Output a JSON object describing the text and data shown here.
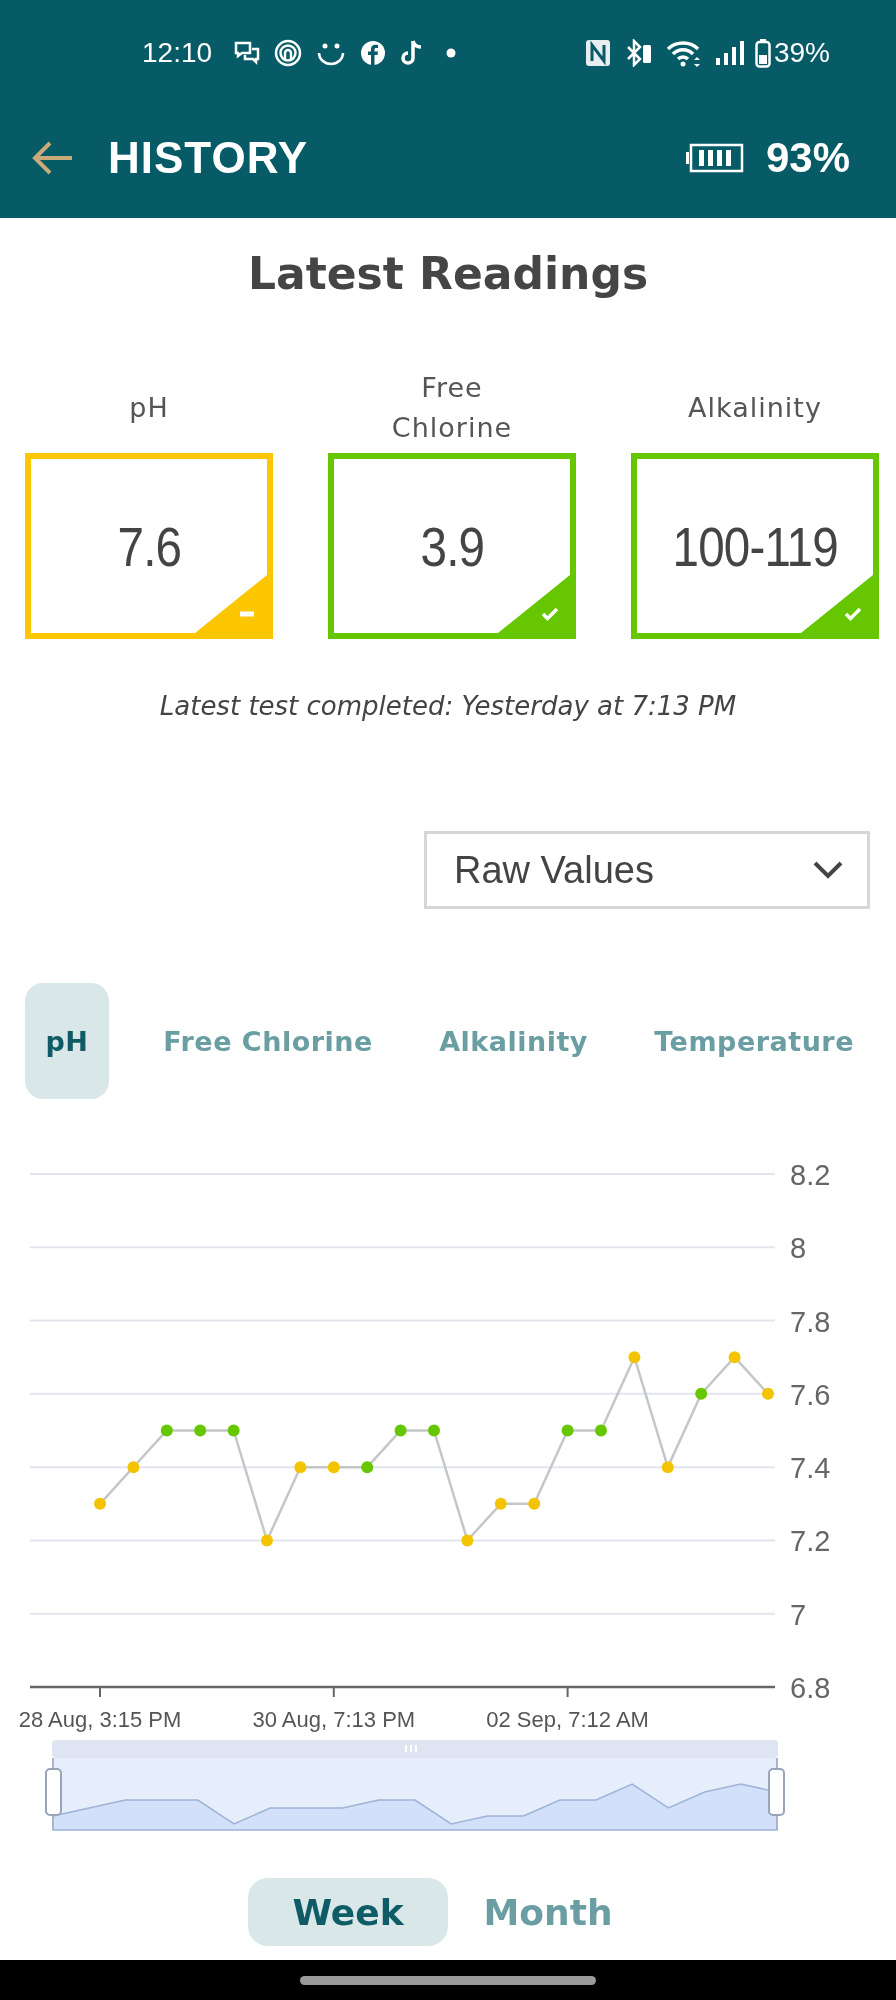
{
  "status_bar": {
    "time": "12:10",
    "battery": "39%"
  },
  "header": {
    "title": "HISTORY",
    "device_battery": "93%"
  },
  "latest": {
    "title": "Latest Readings",
    "readings": [
      {
        "label": "pH",
        "value": "7.6",
        "in_range": false
      },
      {
        "label": "Free Chlorine",
        "value": "3.9",
        "in_range": true
      },
      {
        "label": "Alkalinity",
        "value": "100-119",
        "in_range": true
      }
    ],
    "note": "Latest test completed: Yesterday at 7:13 PM"
  },
  "view_select": {
    "value": "Raw Values"
  },
  "tabs": [
    {
      "label": "pH",
      "selected": true
    },
    {
      "label": "Free Chlorine",
      "selected": false
    },
    {
      "label": "Alkalinity",
      "selected": false
    },
    {
      "label": "Temperature",
      "selected": false
    }
  ],
  "chart": {
    "chart_data": {
      "type": "line",
      "categories": [
        "28 Aug, 3:15 PM",
        null,
        null,
        null,
        null,
        null,
        null,
        "30 Aug, 7:13 PM",
        null,
        null,
        null,
        null,
        null,
        null,
        "02 Sep, 7:12 AM",
        null,
        null,
        null,
        null,
        null,
        null
      ],
      "series": [
        {
          "marker": "circle",
          "color": "#c4c7c8",
          "values": [
            7.3,
            7.4,
            7.5,
            7.5,
            7.5,
            7.2,
            7.4,
            7.4,
            7.4,
            7.5,
            7.5,
            7.2,
            7.3,
            7.3,
            7.5,
            7.5,
            7.7,
            7.4,
            7.6,
            7.7,
            7.6
          ]
        }
      ],
      "ylim": [
        6.8,
        8.2
      ],
      "yticks": [
        6.8,
        7,
        7.2,
        7.4,
        7.6,
        7.8,
        8,
        8.2
      ],
      "grid": true
    },
    "points": [
      {
        "color": "#f5c400"
      },
      {
        "color": "#f5c400"
      },
      {
        "color": "#66c600"
      },
      {
        "color": "#66c600"
      },
      {
        "color": "#66c600"
      },
      {
        "color": "#f5c400"
      },
      {
        "color": "#f5c400"
      },
      {
        "color": "#f5c400"
      },
      {
        "color": "#66c600"
      },
      {
        "color": "#66c600"
      },
      {
        "color": "#66c600"
      },
      {
        "color": "#f5c400"
      },
      {
        "color": "#f5c400"
      },
      {
        "color": "#f5c400"
      },
      {
        "color": "#66c600"
      },
      {
        "color": "#66c600"
      },
      {
        "color": "#f5c400"
      },
      {
        "color": "#f5c400"
      },
      {
        "color": "#66c600"
      },
      {
        "color": "#f5c400"
      },
      {
        "color": "#f5c400"
      }
    ]
  },
  "period_tabs": [
    {
      "label": "Week",
      "selected": true
    },
    {
      "label": "Month",
      "selected": false
    }
  ]
}
